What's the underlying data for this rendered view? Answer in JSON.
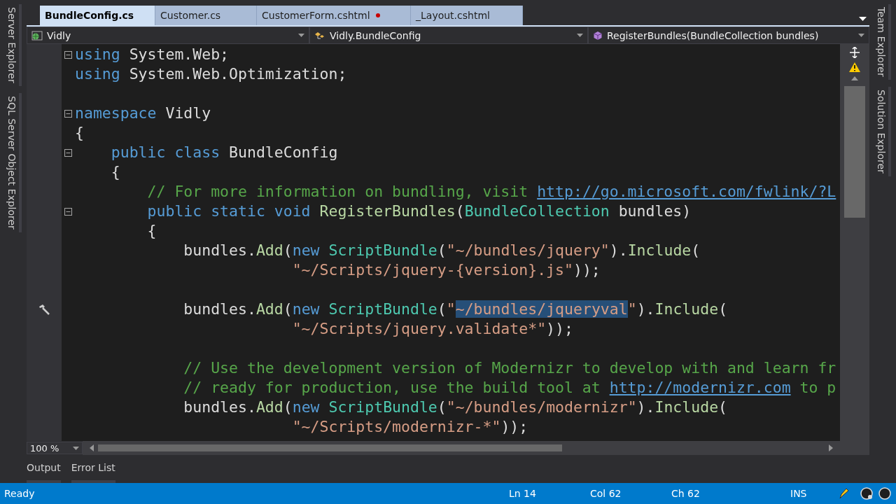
{
  "left_panels": [
    {
      "label": "Server Explorer"
    },
    {
      "label": "SQL Server Object Explorer"
    }
  ],
  "right_panels": [
    {
      "label": "Team Explorer"
    },
    {
      "label": "Solution Explorer"
    }
  ],
  "tabs": [
    {
      "label": "BundleConfig.cs",
      "selected": true,
      "modified": false
    },
    {
      "label": "Customer.cs",
      "selected": false,
      "modified": false
    },
    {
      "label": "CustomerForm.cshtml",
      "selected": false,
      "modified": true
    },
    {
      "label": "_Layout.cshtml",
      "selected": false,
      "modified": false
    }
  ],
  "nav_bar": {
    "project": "Vidly",
    "type": "Vidly.BundleConfig",
    "member": "RegisterBundles(BundleCollection bundles)"
  },
  "code_lines": [
    {
      "kind": "code",
      "foldable": true,
      "tokens": [
        {
          "kind": "kw",
          "text": "using"
        },
        {
          "kind": "plain",
          "text": " System.Web;"
        }
      ]
    },
    {
      "kind": "code",
      "tokens": [
        {
          "kind": "kw",
          "text": "using"
        },
        {
          "kind": "plain",
          "text": " System.Web.Optimization;"
        }
      ]
    },
    {
      "kind": "blank"
    },
    {
      "kind": "code",
      "foldable": true,
      "tokens": [
        {
          "kind": "kw",
          "text": "namespace"
        },
        {
          "kind": "plain",
          "text": " Vidly"
        }
      ]
    },
    {
      "kind": "code",
      "tokens": [
        {
          "kind": "plain",
          "text": "{"
        }
      ]
    },
    {
      "kind": "code",
      "foldable": true,
      "tokens": [
        {
          "kind": "kw",
          "text": "    public class"
        },
        {
          "kind": "plain",
          "text": " BundleConfig"
        }
      ]
    },
    {
      "kind": "code",
      "tokens": [
        {
          "kind": "plain",
          "text": "    {"
        }
      ]
    },
    {
      "kind": "code",
      "tokens": [
        {
          "kind": "comment",
          "text": "        // For more information on bundling, visit "
        },
        {
          "kind": "link",
          "text": "http://go.microsoft.com/fwlink/?L"
        }
      ]
    },
    {
      "kind": "code",
      "foldable": true,
      "tokens": [
        {
          "kind": "kw",
          "text": "        public static void "
        },
        {
          "kind": "method",
          "text": "RegisterBundles"
        },
        {
          "kind": "plain",
          "text": "("
        },
        {
          "kind": "type",
          "text": "BundleCollection"
        },
        {
          "kind": "plain",
          "text": " bundles)"
        }
      ]
    },
    {
      "kind": "code",
      "tokens": [
        {
          "kind": "plain",
          "text": "        {"
        }
      ]
    },
    {
      "kind": "code",
      "tokens": [
        {
          "kind": "plain",
          "text": "            bundles."
        },
        {
          "kind": "method",
          "text": "Add"
        },
        {
          "kind": "plain",
          "text": "("
        },
        {
          "kind": "kw",
          "text": "new "
        },
        {
          "kind": "type",
          "text": "ScriptBundle"
        },
        {
          "kind": "plain",
          "text": "("
        },
        {
          "kind": "str",
          "text": "\"~/bundles/jquery\""
        },
        {
          "kind": "plain",
          "text": ")."
        },
        {
          "kind": "method",
          "text": "Include"
        },
        {
          "kind": "plain",
          "text": "("
        }
      ]
    },
    {
      "kind": "code",
      "tokens": [
        {
          "kind": "str",
          "text": "                        \"~/Scripts/jquery-{version}.js\""
        },
        {
          "kind": "plain",
          "text": "));"
        }
      ]
    },
    {
      "kind": "blank"
    },
    {
      "kind": "code",
      "glyph": true,
      "tokens": [
        {
          "kind": "plain",
          "text": "            bundles."
        },
        {
          "kind": "method",
          "text": "Add"
        },
        {
          "kind": "plain",
          "text": "("
        },
        {
          "kind": "kw",
          "text": "new "
        },
        {
          "kind": "type",
          "text": "ScriptBundle"
        },
        {
          "kind": "plain",
          "text": "("
        },
        {
          "kind": "str",
          "text": "\""
        },
        {
          "kind": "selected",
          "text": "~/bundles/jqueryval"
        },
        {
          "kind": "str",
          "text": "\""
        },
        {
          "kind": "plain",
          "text": ")."
        },
        {
          "kind": "method",
          "text": "Include"
        },
        {
          "kind": "plain",
          "text": "("
        }
      ]
    },
    {
      "kind": "code",
      "tokens": [
        {
          "kind": "str",
          "text": "                        \"~/Scripts/jquery.validate*\""
        },
        {
          "kind": "plain",
          "text": "));"
        }
      ]
    },
    {
      "kind": "blank"
    },
    {
      "kind": "code",
      "tokens": [
        {
          "kind": "comment",
          "text": "            // Use the development version of Modernizr to develop with and learn fr"
        }
      ]
    },
    {
      "kind": "code",
      "tokens": [
        {
          "kind": "comment",
          "text": "            // ready for production, use the build tool at "
        },
        {
          "kind": "link",
          "text": "http://modernizr.com"
        },
        {
          "kind": "comment",
          "text": " to p"
        }
      ]
    },
    {
      "kind": "code",
      "tokens": [
        {
          "kind": "plain",
          "text": "            bundles."
        },
        {
          "kind": "method",
          "text": "Add"
        },
        {
          "kind": "plain",
          "text": "("
        },
        {
          "kind": "kw",
          "text": "new "
        },
        {
          "kind": "type",
          "text": "ScriptBundle"
        },
        {
          "kind": "plain",
          "text": "("
        },
        {
          "kind": "str",
          "text": "\"~/bundles/modernizr\""
        },
        {
          "kind": "plain",
          "text": ")."
        },
        {
          "kind": "method",
          "text": "Include"
        },
        {
          "kind": "plain",
          "text": "("
        }
      ]
    },
    {
      "kind": "code",
      "tokens": [
        {
          "kind": "str",
          "text": "                        \"~/Scripts/modernizr-*\""
        },
        {
          "kind": "plain",
          "text": "));"
        }
      ]
    }
  ],
  "zoom": "100 %",
  "bottom_tabs": [
    {
      "label": "Output",
      "selected": false
    },
    {
      "label": "Error List",
      "selected": false
    }
  ],
  "status_bar": {
    "message": "Ready",
    "line": "Ln 14",
    "column": "Col 62",
    "char": "Ch 62",
    "mode": "INS"
  }
}
